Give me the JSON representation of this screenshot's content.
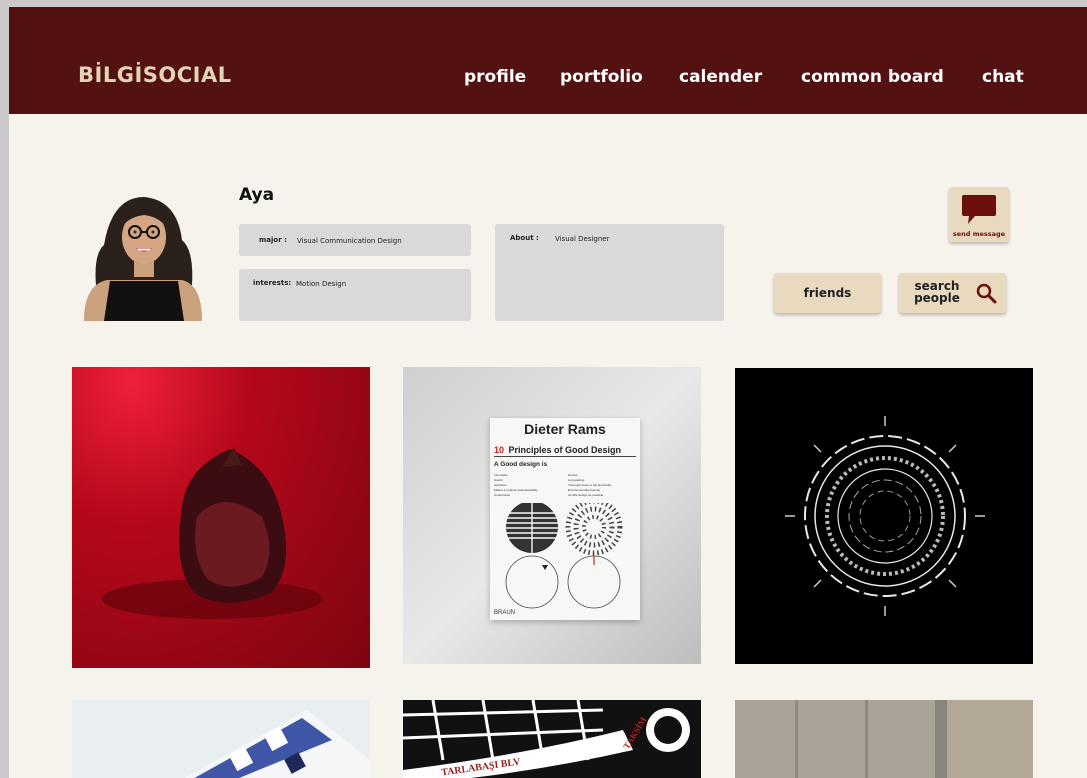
{
  "header": {
    "brand": "BİLGİSOCIAL",
    "nav": [
      "profile",
      "portfolio",
      "calender",
      "common board",
      "chat"
    ]
  },
  "profile": {
    "name": "Aya",
    "major_label": "major :",
    "major_value": "Visual Communication Design",
    "interests_label": "interests:",
    "interests_value": "Motion Design",
    "about_label": "About :",
    "about_value": "Visual Designer"
  },
  "actions": {
    "send_message": "send message",
    "friends": "friends",
    "search_people_line1": "search",
    "search_people_line2": "people"
  },
  "gallery": {
    "poster": {
      "title": "Dieter Rams",
      "number": "10",
      "subtitle": "Principles of Good Design",
      "heading": "A Good design is",
      "principles": [
        "Innovative",
        "Useful",
        "Aesthetic",
        "Makes a product understandable",
        "Unobtrusive",
        "Honest",
        "Long-lasting",
        "Thorough down to the last detail",
        "Environmentally-friendly",
        "As little design as possible"
      ],
      "brand": "BRAUN"
    },
    "map": {
      "street": "TARLABAŞI BLV",
      "district": "TAKSİM"
    }
  },
  "colors": {
    "header_bg": "#531211",
    "brand": "#e5d3b7",
    "page_bg": "#f6f2ec",
    "box_bg": "#d9d9d9",
    "button_bg": "#e9d9bf",
    "accent": "#6b0f0f"
  }
}
